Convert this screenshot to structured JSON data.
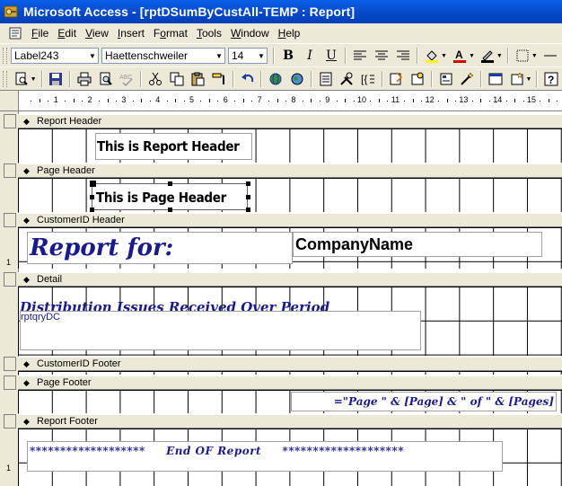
{
  "window": {
    "title": "Microsoft Access - [rptDSumByCustAll-TEMP : Report]"
  },
  "menu": {
    "items": [
      "File",
      "Edit",
      "View",
      "Insert",
      "Format",
      "Tools",
      "Window",
      "Help"
    ],
    "underline": [
      "F",
      "E",
      "V",
      "I",
      "o",
      "T",
      "W",
      "H"
    ]
  },
  "toolbar_format": {
    "object_combo": "Label243",
    "font_combo": "Haettenschweiler",
    "size_combo": "14",
    "bold": "B",
    "italic": "I",
    "underline": "U"
  },
  "ruler": {
    "numbers": [
      "1",
      "2",
      "3",
      "4",
      "5",
      "6",
      "7",
      "8",
      "9",
      "10",
      "11",
      "12",
      "13",
      "14",
      "15"
    ]
  },
  "sections": {
    "report_header": "Report Header",
    "page_header": "Page Header",
    "customer_header": "CustomerID Header",
    "detail": "Detail",
    "customer_footer": "CustomerID Footer",
    "page_footer": "Page Footer",
    "report_footer": "Report Footer"
  },
  "controls": {
    "report_header_label": "This is Report Header",
    "page_header_label": "This is Page Header",
    "report_for": "Report for:",
    "company_name": "CompanyName",
    "distribution": "Distribution Issues Received Over Period",
    "subreport": "rptqryDC",
    "page_expr": "=\"Page \" & [Page] & \" of \" & [Pages]",
    "end_report": "*******************     End OF Report     ********************"
  },
  "left_ruler": {
    "mark": "1"
  },
  "colors": {
    "titlebar": "#0548c6",
    "label_blue": "#1a1a8a",
    "chrome": "#ece9d8"
  }
}
